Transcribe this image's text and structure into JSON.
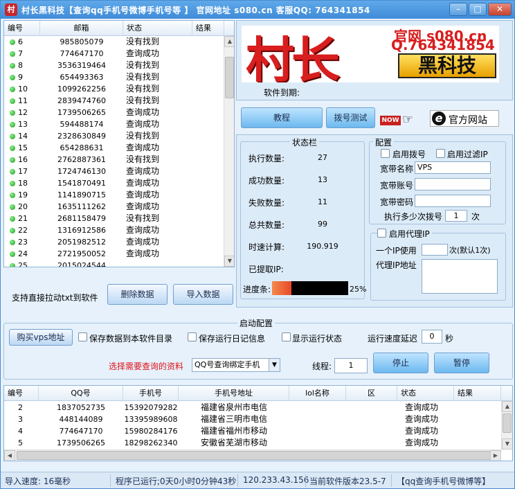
{
  "window": {
    "title": "村长黑科技【查询qq手机号微博手机号等 】   官网地址 s080.cn  客服QQ:  764341854",
    "icon_text": "村",
    "minimize_glyph": "–",
    "maximize_glyph": "□",
    "close_glyph": "✕"
  },
  "top_grid": {
    "headers": [
      "编号",
      "邮箱",
      "状态",
      "结果"
    ],
    "rows": [
      {
        "id": "6",
        "email": "985805079",
        "status": "没有找到"
      },
      {
        "id": "7",
        "email": "774647170",
        "status": "查询成功"
      },
      {
        "id": "8",
        "email": "3536319464",
        "status": "没有找到"
      },
      {
        "id": "9",
        "email": "654493363",
        "status": "没有找到"
      },
      {
        "id": "10",
        "email": "1099262256",
        "status": "没有找到"
      },
      {
        "id": "11",
        "email": "2839474760",
        "status": "没有找到"
      },
      {
        "id": "12",
        "email": "1739506265",
        "status": "查询成功"
      },
      {
        "id": "13",
        "email": "594488174",
        "status": "查询成功"
      },
      {
        "id": "14",
        "email": "2328630849",
        "status": "没有找到"
      },
      {
        "id": "15",
        "email": "654288631",
        "status": "查询成功"
      },
      {
        "id": "16",
        "email": "2762887361",
        "status": "没有找到"
      },
      {
        "id": "17",
        "email": "1724746130",
        "status": "查询成功"
      },
      {
        "id": "18",
        "email": "1541870491",
        "status": "查询成功"
      },
      {
        "id": "19",
        "email": "1141890715",
        "status": "查询成功"
      },
      {
        "id": "20",
        "email": "1635111262",
        "status": "查询成功"
      },
      {
        "id": "21",
        "email": "2681158479",
        "status": "没有找到"
      },
      {
        "id": "22",
        "email": "1316912586",
        "status": "查询成功"
      },
      {
        "id": "23",
        "email": "2051982512",
        "status": "查询成功"
      },
      {
        "id": "24",
        "email": "2721950052",
        "status": "查询成功"
      },
      {
        "id": "25",
        "email": "2015024544",
        "status": ""
      }
    ]
  },
  "left_tools": {
    "drag_hint": "支持直接拉动txt到软件",
    "delete_label": "删除数据",
    "import_label": "导入数据"
  },
  "logo": {
    "big_text": "村长",
    "site_text": "官网 s080.cn",
    "qq_text": "Q.764341854",
    "brand_text": "黑科技"
  },
  "expiry_label": "软件到期:",
  "buttons": {
    "tutorial": "教程",
    "dial_test": "拨号测试",
    "now_badge": "NOW",
    "official_site": "官方网站"
  },
  "status_panel": {
    "title": "状态栏",
    "items": [
      {
        "label": "执行数量:",
        "value": "27"
      },
      {
        "label": "成功数量:",
        "value": "13"
      },
      {
        "label": "失败数量:",
        "value": "11"
      },
      {
        "label": "总共数量:",
        "value": "99"
      },
      {
        "label": "时速计算:",
        "value": "190.919"
      },
      {
        "label": "已提取IP:",
        "value": ""
      }
    ],
    "progress_label": "进度条:",
    "progress_text": "25%",
    "progress_fraction": 0.25
  },
  "config_panel": {
    "title": "配置",
    "enable_dial": "启用拨号",
    "enable_filter_ip": "启用过滤IP",
    "broadband_name_label": "宽带名称",
    "broadband_name_value": "VPS",
    "broadband_account_label": "宽带账号",
    "broadband_password_label": "宽带密码",
    "dial_every_label": "执行多少次拨号",
    "dial_every_value": "1",
    "dial_every_unit": "次",
    "enable_proxy": "启用代理IP",
    "ip_use_label": "一个IP使用",
    "ip_use_unit": "次(默认1次)",
    "proxy_addr_label": "代理IP地址"
  },
  "startup": {
    "title": "启动配置",
    "buy_vps": "购买vps地址",
    "save_data": "保存数据到本软件目录",
    "save_log": "保存运行日记信息",
    "show_status": "显示运行状态",
    "delay_label": "运行速度延迟",
    "delay_value": "0",
    "delay_unit": "秒",
    "select_label": "选择需要查询的资料",
    "select_value": "QQ号查询绑定手机",
    "threads_label": "线程:",
    "threads_value": "1",
    "stop_label": "停止",
    "pause_label": "暂停"
  },
  "bottom_grid": {
    "headers": [
      "编号",
      "QQ号",
      "手机号",
      "手机号地址",
      "lol名称",
      "区",
      "状态",
      "结果"
    ],
    "rows": [
      {
        "id": "2",
        "qq": "1837052735",
        "phone": "15392079282",
        "addr": "福建省泉州市电信",
        "lol": "",
        "area": "",
        "status": "查询成功",
        "result": ""
      },
      {
        "id": "3",
        "qq": "448144089",
        "phone": "13395989608",
        "addr": "福建省三明市电信",
        "lol": "",
        "area": "",
        "status": "查询成功",
        "result": ""
      },
      {
        "id": "4",
        "qq": "774647170",
        "phone": "15980284176",
        "addr": "福建省福州市移动",
        "lol": "",
        "area": "",
        "status": "查询成功",
        "result": ""
      },
      {
        "id": "5",
        "qq": "1739506265",
        "phone": "18298262340",
        "addr": "安徽省芜湖市移动",
        "lol": "",
        "area": "",
        "status": "查询成功",
        "result": ""
      }
    ]
  },
  "statusbar": {
    "import_speed": "导入速度:  16毫秒",
    "runtime": "程序已运行;0天0小时0分钟43秒",
    "ip": "120.233.43.156",
    "version": "当前软件版本23.5-7",
    "tagline": "【qq查询手机号微博等】"
  },
  "colors": {
    "accent": "#4a8ccc",
    "progress_fill": "#ef6a3a",
    "select_label": "#e0121a",
    "logo_red": "#d81e1e"
  }
}
